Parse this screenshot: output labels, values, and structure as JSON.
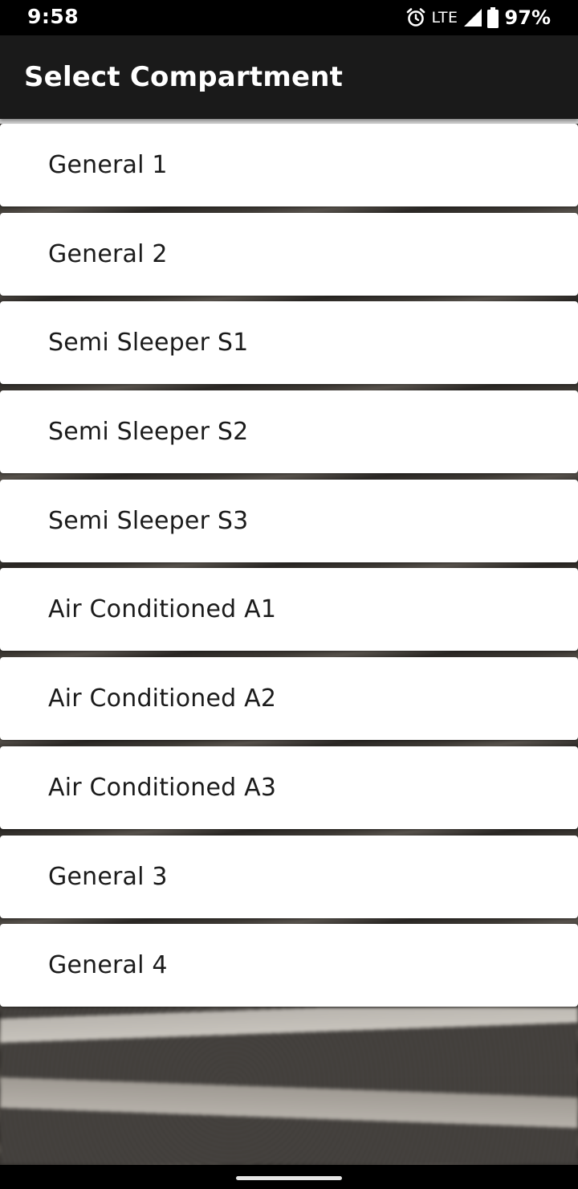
{
  "status_bar": {
    "time": "9:58",
    "network": "LTE",
    "battery": "97%",
    "icons": [
      "alarm-icon",
      "signal-icon",
      "battery-icon"
    ]
  },
  "app_bar": {
    "title": "Select Compartment"
  },
  "compartments": [
    {
      "label": "General 1"
    },
    {
      "label": "General 2"
    },
    {
      "label": "Semi Sleeper S1"
    },
    {
      "label": "Semi Sleeper S2"
    },
    {
      "label": "Semi Sleeper S3"
    },
    {
      "label": "Air Conditioned A1"
    },
    {
      "label": "Air Conditioned A2"
    },
    {
      "label": "Air Conditioned A3"
    },
    {
      "label": "General 3"
    },
    {
      "label": "General 4"
    }
  ],
  "colors": {
    "app_bar": "#1a1a1a",
    "status_bar": "#000000",
    "card": "#ffffff",
    "text": "#1b1b1b"
  }
}
